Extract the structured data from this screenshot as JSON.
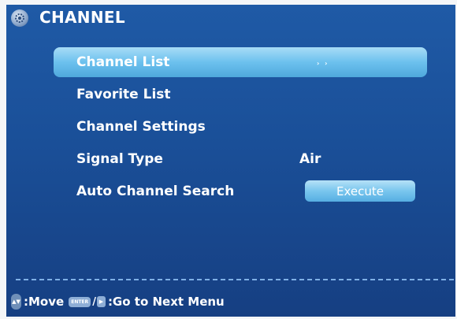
{
  "header": {
    "title": "CHANNEL"
  },
  "menu": {
    "items": [
      {
        "label": "Channel List",
        "value": "",
        "selected": true,
        "arrow": "› ›"
      },
      {
        "label": "Favorite List",
        "value": ""
      },
      {
        "label": "Channel Settings",
        "value": ""
      },
      {
        "label": "Signal Type",
        "value": "Air"
      },
      {
        "label": "Auto Channel Search",
        "button": "Execute"
      }
    ]
  },
  "footer": {
    "move_label": ":Move",
    "enter_key_label": "ENTER",
    "next_label": ":Go to Next Menu"
  },
  "icons": {
    "logo": "gear-logo-icon",
    "move": "up-down-arrows-icon",
    "enter": "enter-key-icon",
    "right": "right-arrow-key-icon"
  },
  "colors": {
    "background": "#1a4f98",
    "highlight": "#6cc1ee",
    "text": "#ffffff"
  }
}
